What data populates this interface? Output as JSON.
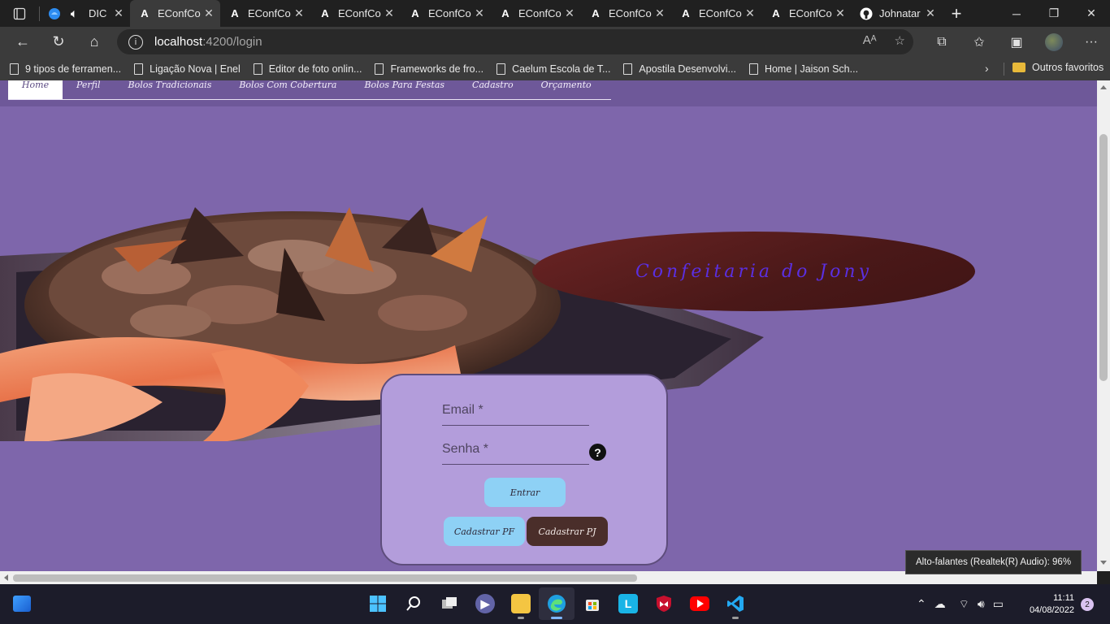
{
  "browser": {
    "tabs": [
      {
        "title": "DIC",
        "icon": "edge-drop-icon",
        "active": false
      },
      {
        "title": "EConfCo",
        "icon": "angular-icon",
        "active": true
      },
      {
        "title": "EConfCo",
        "icon": "angular-icon",
        "active": false
      },
      {
        "title": "EConfCo",
        "icon": "angular-icon",
        "active": false
      },
      {
        "title": "EConfCo",
        "icon": "angular-icon",
        "active": false
      },
      {
        "title": "EConfCo",
        "icon": "angular-icon",
        "active": false
      },
      {
        "title": "EConfCo",
        "icon": "angular-icon",
        "active": false
      },
      {
        "title": "EConfCo",
        "icon": "angular-icon",
        "active": false
      },
      {
        "title": "EConfCo",
        "icon": "angular-icon",
        "active": false
      },
      {
        "title": "Johnatar",
        "icon": "github-icon",
        "active": false
      }
    ],
    "address": {
      "host": "localhost",
      "path": ":4200/login"
    },
    "bookmarks": [
      "9 tipos de ferramen...",
      "Ligação Nova | Enel",
      "Editor de foto onlin...",
      "Frameworks de fro...",
      "Caelum Escola de T...",
      "Apostila Desenvolvi...",
      "Home | Jaison Sch..."
    ],
    "other_favorites": "Outros favoritos"
  },
  "site": {
    "menu": [
      "Home",
      "Perfil",
      "Bolos Tradicionais",
      "Bolos Com Cobertura",
      "Bolos Para Festas",
      "Cadastro",
      "Orçamento"
    ],
    "title": "Confeitaria do Jony"
  },
  "login": {
    "email_placeholder": "Email *",
    "password_placeholder": "Senha *",
    "help_symbol": "?",
    "submit_label": "Entrar",
    "register_pf_label": "Cadastrar PF",
    "register_pj_label": "Cadastrar PJ"
  },
  "system": {
    "volume_tooltip": "Alto-falantes (Realtek(R) Audio): 96%",
    "time": "11:11",
    "date": "04/08/2022",
    "notifications": "2"
  },
  "colors": {
    "page_bg": "#7e66ab",
    "card_bg": "#b39ddb",
    "button_light": "#8ed1f5",
    "button_dark": "#4a2e2a",
    "title_oval": "#5a1e1e",
    "title_text": "#5a2fe0"
  }
}
